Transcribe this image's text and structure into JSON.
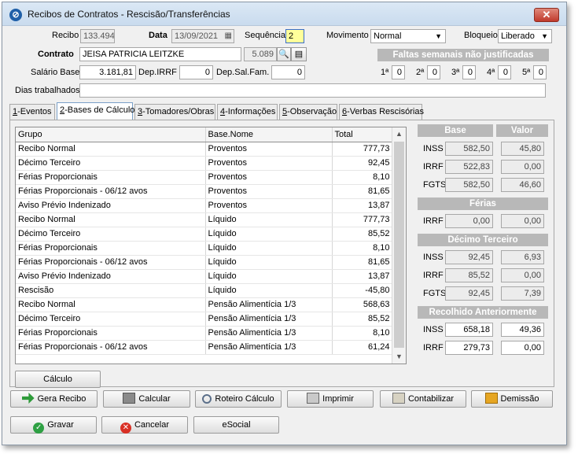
{
  "window": {
    "title": "Recibos de Contratos - Rescisão/Transferências"
  },
  "header": {
    "recibo_label": "Recibo",
    "recibo_value": "133.494",
    "data_label": "Data",
    "data_value": "13/09/2021",
    "sequencia_label": "Sequência",
    "sequencia_value": "2",
    "movimento_label": "Movimento",
    "movimento_value": "Normal",
    "bloqueio_label": "Bloqueio",
    "bloqueio_value": "Liberado",
    "contrato_label": "Contrato",
    "contrato_name": "JEISA PATRICIA LEITZKE",
    "contrato_code": "5.089",
    "faltas_title": "Faltas semanais não justificadas",
    "salario_label": "Salário Base",
    "salario_value": "3.181,81",
    "dep_irrf_label": "Dep.IRRF",
    "dep_irrf_value": "0",
    "dep_salfam_label": "Dep.Sal.Fam.",
    "dep_salfam_value": "0",
    "dias_label": "Dias trabalhados",
    "dias_value": "",
    "faltas": [
      {
        "label": "1ª",
        "value": "0"
      },
      {
        "label": "2ª",
        "value": "0"
      },
      {
        "label": "3ª",
        "value": "0"
      },
      {
        "label": "4ª",
        "value": "0"
      },
      {
        "label": "5ª",
        "value": "0"
      }
    ]
  },
  "tabs": [
    {
      "key": "1",
      "label": "-Eventos"
    },
    {
      "key": "2",
      "label": "-Bases de Cálculo"
    },
    {
      "key": "3",
      "label": "-Tomadores/Obras"
    },
    {
      "key": "4",
      "label": "-Informações"
    },
    {
      "key": "5",
      "label": "-Observação"
    },
    {
      "key": "6",
      "label": "-Verbas Rescisórias"
    }
  ],
  "grid": {
    "columns": [
      "Grupo",
      "Base.Nome",
      "Total"
    ],
    "rows": [
      [
        "Recibo Normal",
        "Proventos",
        "777,73"
      ],
      [
        "Décimo Terceiro",
        "Proventos",
        "92,45"
      ],
      [
        "Férias Proporcionais",
        "Proventos",
        "8,10"
      ],
      [
        "Férias Proporcionais - 06/12 avos",
        "Proventos",
        "81,65"
      ],
      [
        "Aviso Prévio Indenizado",
        "Proventos",
        "13,87"
      ],
      [
        "Recibo Normal",
        "Líquido",
        "777,73"
      ],
      [
        "Décimo Terceiro",
        "Líquido",
        "85,52"
      ],
      [
        "Férias Proporcionais",
        "Líquido",
        "8,10"
      ],
      [
        "Férias Proporcionais - 06/12 avos",
        "Líquido",
        "81,65"
      ],
      [
        "Aviso Prévio Indenizado",
        "Líquido",
        "13,87"
      ],
      [
        "Rescisão",
        "Líquido",
        "-45,80"
      ],
      [
        "Recibo Normal",
        "Pensão Alimentícia 1/3",
        "568,63"
      ],
      [
        "Décimo Terceiro",
        "Pensão Alimentícia 1/3",
        "85,52"
      ],
      [
        "Férias Proporcionais",
        "Pensão Alimentícia 1/3",
        "8,10"
      ],
      [
        "Férias Proporcionais - 06/12 avos",
        "Pensão Alimentícia 1/3",
        "61,24"
      ]
    ]
  },
  "right_panel": {
    "base_header": "Base",
    "valor_header": "Valor",
    "main": [
      {
        "label": "INSS",
        "base": "582,50",
        "valor": "45,80"
      },
      {
        "label": "IRRF",
        "base": "522,83",
        "valor": "0,00"
      },
      {
        "label": "FGTS",
        "base": "582,50",
        "valor": "46,60"
      }
    ],
    "ferias_title": "Férias",
    "ferias": [
      {
        "label": "IRRF",
        "base": "0,00",
        "valor": "0,00"
      }
    ],
    "decimo_title": "Décimo Terceiro",
    "decimo": [
      {
        "label": "INSS",
        "base": "92,45",
        "valor": "6,93"
      },
      {
        "label": "IRRF",
        "base": "85,52",
        "valor": "0,00"
      },
      {
        "label": "FGTS",
        "base": "92,45",
        "valor": "7,39"
      }
    ],
    "recolhido_title": "Recolhido Anteriormente",
    "recolhido": [
      {
        "label": "INSS",
        "base": "658,18",
        "valor": "49,36"
      },
      {
        "label": "IRRF",
        "base": "279,73",
        "valor": "0,00"
      }
    ]
  },
  "buttons": {
    "calculo": "Cálculo",
    "gera_recibo": "Gera Recibo",
    "calcular": "Calcular",
    "roteiro": "Roteiro Cálculo",
    "imprimir": "Imprimir",
    "contabilizar": "Contabilizar",
    "demissao": "Demissão",
    "gravar": "Gravar",
    "cancelar": "Cancelar",
    "esocial": "eSocial"
  },
  "colors": {
    "accent": "#1f5fa8",
    "section_header": "#b8b8b8",
    "close": "#c0392b"
  }
}
